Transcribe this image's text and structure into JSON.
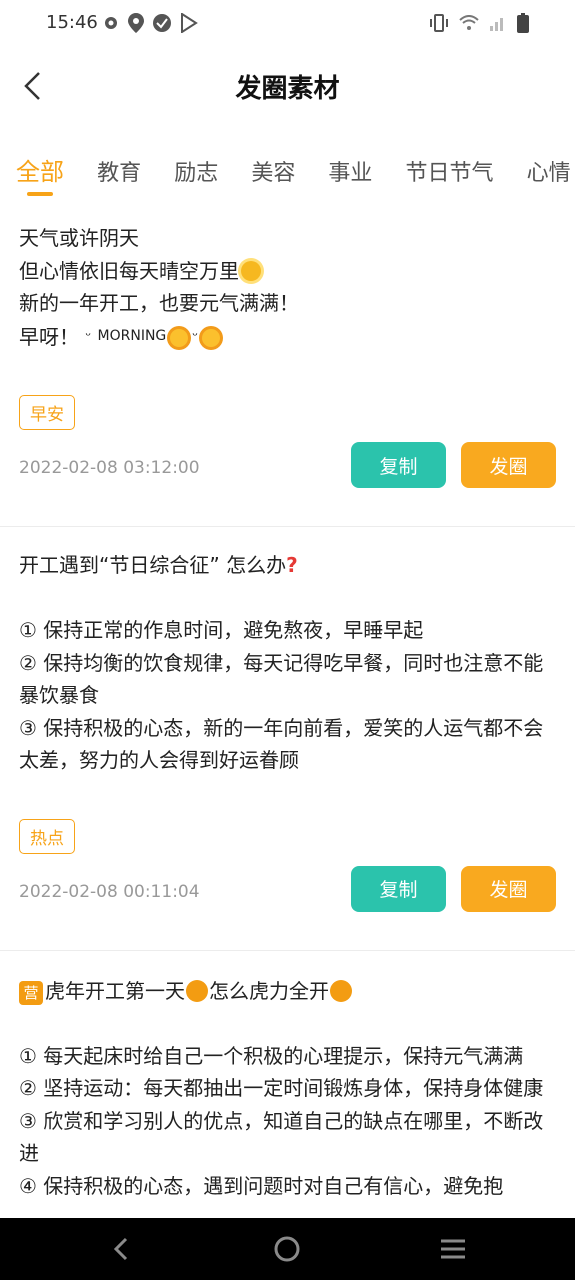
{
  "status": {
    "time": "15:46"
  },
  "header": {
    "title": "发圈素材"
  },
  "tabs": [
    {
      "label": "全部",
      "active": true
    },
    {
      "label": "教育"
    },
    {
      "label": "励志"
    },
    {
      "label": "美容"
    },
    {
      "label": "事业"
    },
    {
      "label": "节日节气"
    },
    {
      "label": "心情"
    }
  ],
  "posts": [
    {
      "lines": [
        "天气或许阴天",
        "但心情依旧每天晴空万里",
        "新的一年开工，也要元气满满！",
        "早呀！"
      ],
      "morning_text": "MORNING",
      "tag": "早安",
      "date": "2022-02-08 03:12:00",
      "copy_label": "复制",
      "post_label": "发圈"
    },
    {
      "title": "开工遇到“节日综合征” 怎么办",
      "lines": [
        "① 保持正常的作息时间，避免熬夜，早睡早起",
        "② 保持均衡的饮食规律，每天记得吃早餐，同时也注意不能暴饮暴食",
        "③ 保持积极的心态，新的一年向前看，爱笑的人运气都不会太差，努力的人会得到好运眷顾"
      ],
      "tag": "热点",
      "date": "2022-02-08 00:11:04",
      "copy_label": "复制",
      "post_label": "发圈"
    },
    {
      "title_part1": "虎年开工第一天",
      "title_part2": "怎么虎力全开",
      "ying_char": "营",
      "lines": [
        "① 每天起床时给自己一个积极的心理提示，保持元气满满",
        "② 坚持运动：每天都抽出一定时间锻炼身体，保持身体健康",
        "③ 欣赏和学习别人的优点，知道自己的缺点在哪里，不断改进",
        "④ 保持积极的心态，遇到问题时对自己有信心，避免抱"
      ]
    }
  ],
  "colors": {
    "accent": "#f7a318",
    "copy_button": "#2bc3ac",
    "post_button": "#f9a91f"
  }
}
